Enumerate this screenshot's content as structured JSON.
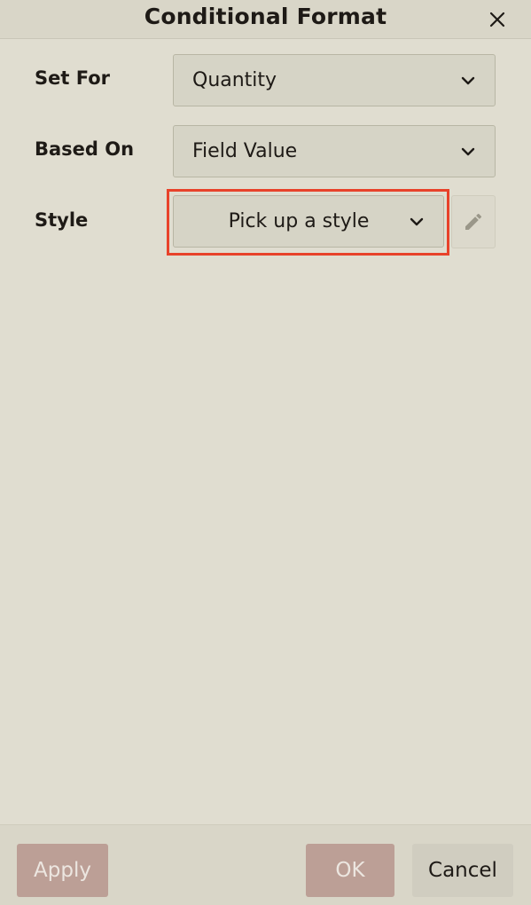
{
  "dialog": {
    "title": "Conditional Format",
    "close_icon": "close-icon"
  },
  "form": {
    "set_for": {
      "label": "Set For",
      "value": "Quantity"
    },
    "based_on": {
      "label": "Based On",
      "value": "Field Value"
    },
    "style": {
      "label": "Style",
      "value": "Pick up a style",
      "edit_icon": "pencil-icon"
    }
  },
  "footer": {
    "apply_label": "Apply",
    "ok_label": "OK",
    "cancel_label": "Cancel"
  },
  "colors": {
    "background": "#e0ddd0",
    "highlight": "#e8422a",
    "primary_disabled": "#bc9f96"
  }
}
